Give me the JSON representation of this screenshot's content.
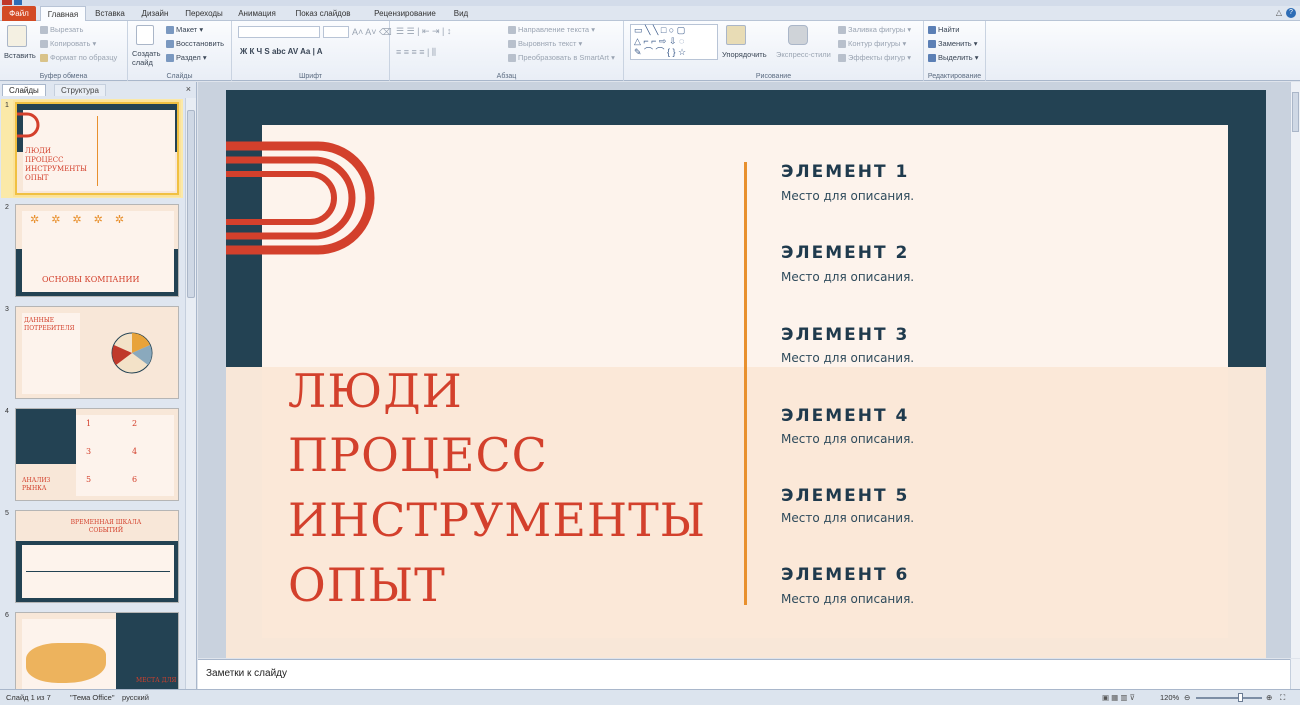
{
  "ribbon_tabs": [
    "Файл",
    "Главная",
    "Вставка",
    "Дизайн",
    "Переходы",
    "Анимация",
    "Показ слайдов",
    "Рецензирование",
    "Вид"
  ],
  "clipboard": {
    "paste": "Вставить",
    "cut": "Вырезать",
    "copy": "Копировать",
    "format_painter": "Формат по образцу",
    "label": "Буфер обмена"
  },
  "slides_group": {
    "new_slide": "Создать слайд",
    "layout": "Макет",
    "reset": "Восстановить",
    "section": "Раздел",
    "label": "Слайды"
  },
  "font_group": {
    "label": "Шрифт"
  },
  "paragraph_group": {
    "text_direction": "Направление текста",
    "align_text": "Выровнять текст",
    "smartart": "Преобразовать в SmartArt",
    "label": "Абзац"
  },
  "drawing_group": {
    "arrange": "Упорядочить",
    "quick_styles": "Экспресс-стили",
    "shape_fill": "Заливка фигуры",
    "shape_outline": "Контур фигуры",
    "shape_effects": "Эффекты фигур",
    "label": "Рисование"
  },
  "editing_group": {
    "find": "Найти",
    "replace": "Заменить",
    "select": "Выделить",
    "label": "Редактирование"
  },
  "left_panel": {
    "tab_slides": "Слайды",
    "tab_outline": "Структура",
    "close": "×"
  },
  "thumbnails": [
    {
      "num": "1",
      "lines": [
        "ЛЮДИ",
        "ПРОЦЕСС",
        "ИНСТРУМЕНТЫ",
        "ОПЫТ"
      ]
    },
    {
      "num": "2",
      "title": "ОСНОВЫ КОМПАНИИ"
    },
    {
      "num": "3",
      "title": "ДАННЫЕ ПОТРЕБИТЕЛЯ"
    },
    {
      "num": "4",
      "title": "АНАЛИЗ РЫНКА",
      "nums": [
        "1",
        "2",
        "3",
        "4",
        "5",
        "6"
      ]
    },
    {
      "num": "5",
      "title": "ВРЕМЕННАЯ ШКАЛА СОБЫТИЙ"
    },
    {
      "num": "6",
      "title": "МЕСТА ДЛЯ"
    }
  ],
  "slide": {
    "title_lines": [
      "ЛЮДИ",
      "ПРОЦЕСС",
      "ИНСТРУМЕНТЫ",
      "ОПЫТ"
    ],
    "items": [
      {
        "title": "ЭЛЕМЕНТ 1",
        "desc": "Место для описания."
      },
      {
        "title": "ЭЛЕМЕНТ 2",
        "desc": "Место для описания."
      },
      {
        "title": "ЭЛЕМЕНТ 3",
        "desc": "Место для описания."
      },
      {
        "title": "ЭЛЕМЕНТ 4",
        "desc": "Место для описания."
      },
      {
        "title": "ЭЛЕМЕНТ 5",
        "desc": "Место для описания."
      },
      {
        "title": "ЭЛЕМЕНТ 6",
        "desc": "Место для описания."
      }
    ]
  },
  "notes": {
    "placeholder": "Заметки к слайду"
  },
  "status": {
    "slide_pos": "Слайд 1 из 7",
    "theme": "\"Тема Office\"",
    "lang": "русский",
    "zoom": "120%"
  },
  "colors": {
    "accent_red": "#d3402c",
    "navy": "#234253",
    "orange": "#e8902e",
    "cream": "#fdf3ec"
  }
}
